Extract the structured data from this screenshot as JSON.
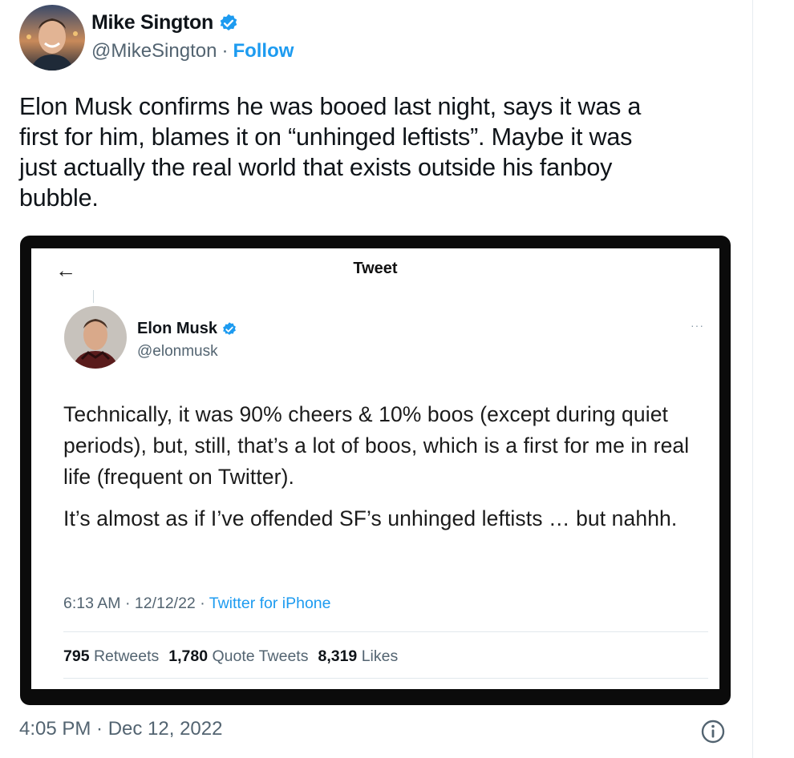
{
  "author": {
    "name": "Mike Sington",
    "handle": "@MikeSington",
    "separator": "·",
    "follow_label": "Follow"
  },
  "tweet": {
    "text": "Elon Musk confirms he was booed last night, says it was a\nfirst for him, blames it on “unhinged leftists”. Maybe it was\njust actually the real world that exists outside his fanboy\nbubble.",
    "timestamp": "4:05 PM · Dec 12, 2022"
  },
  "embedded": {
    "header_title": "Tweet",
    "back_icon": "arrow-left-icon",
    "author_name": "Elon Musk",
    "author_handle": "@elonmusk",
    "more_label": "···",
    "body_line_1": "Technically, it was 90% cheers & 10% boos (except during quiet periods), but, still, that’s a lot of boos, which is a first for me in real life (frequent on Twitter).",
    "body_line_2": "It’s almost as if I’ve offended SF’s unhinged leftists … but nahhh.",
    "meta_time": "6:13 AM · 12/12/22 · ",
    "meta_app": "Twitter for iPhone",
    "stats": [
      {
        "count": "795",
        "label": "Retweets"
      },
      {
        "count": "1,780",
        "label": "Quote Tweets"
      },
      {
        "count": "8,319",
        "label": "Likes"
      }
    ]
  },
  "icons": {
    "verified": "verified-badge-icon",
    "info": "info-icon"
  },
  "colors": {
    "accent": "#1d9bf0",
    "text": "#0f1419",
    "muted": "#536471",
    "frame": "#0b0b0b"
  }
}
